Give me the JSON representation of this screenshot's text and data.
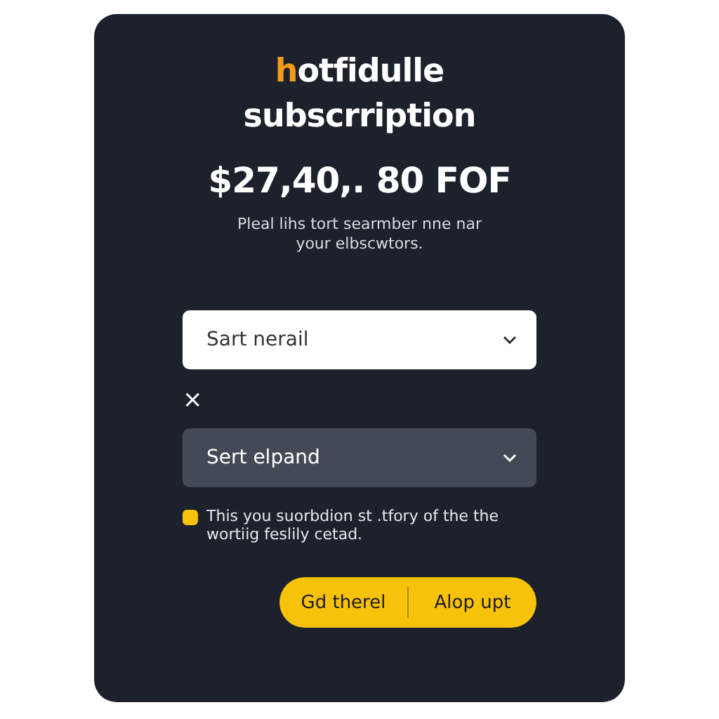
{
  "brand": {
    "accent": "h",
    "rest": "otfidulle"
  },
  "title": "subscrription",
  "price": "$27,40,. 80 FOF",
  "description": "Pleal lihs tort searmber nne nar your elbscwtors.",
  "selects": [
    {
      "value": "Sart nerail",
      "kind": "light"
    },
    {
      "value": "Sert elpand",
      "kind": "dark"
    }
  ],
  "close_icon": "×",
  "consent": {
    "checked": true,
    "text": "This you suorbdion st .tfory of the the wortiig feslily cetad."
  },
  "buttons": [
    "Gd therel",
    "Alop upt"
  ]
}
